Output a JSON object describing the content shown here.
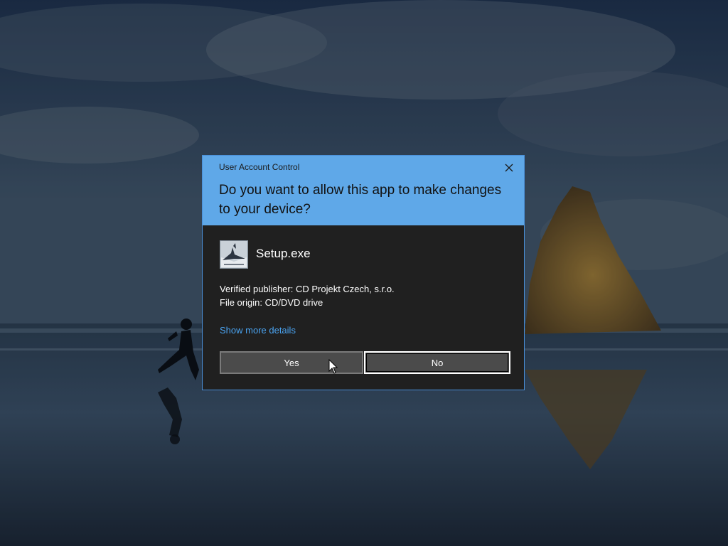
{
  "dialog": {
    "caption": "User Account Control",
    "question": "Do you want to allow this app to make changes to your device?",
    "app_name": "Setup.exe",
    "publisher_line": "Verified publisher: CD Projekt Czech, s.r.o.",
    "origin_line": "File origin: CD/DVD drive",
    "details_link": "Show more details",
    "yes_label": "Yes",
    "no_label": "No",
    "close_icon": "close-icon",
    "app_icon": "setup-app-icon"
  },
  "colors": {
    "header_bg": "#5fa8e8",
    "body_bg": "#202020",
    "link": "#4aa3f0",
    "button_bg": "#4b4b4b"
  },
  "desktop": {
    "wallpaper": "beach-rock-runner-wallpaper"
  }
}
